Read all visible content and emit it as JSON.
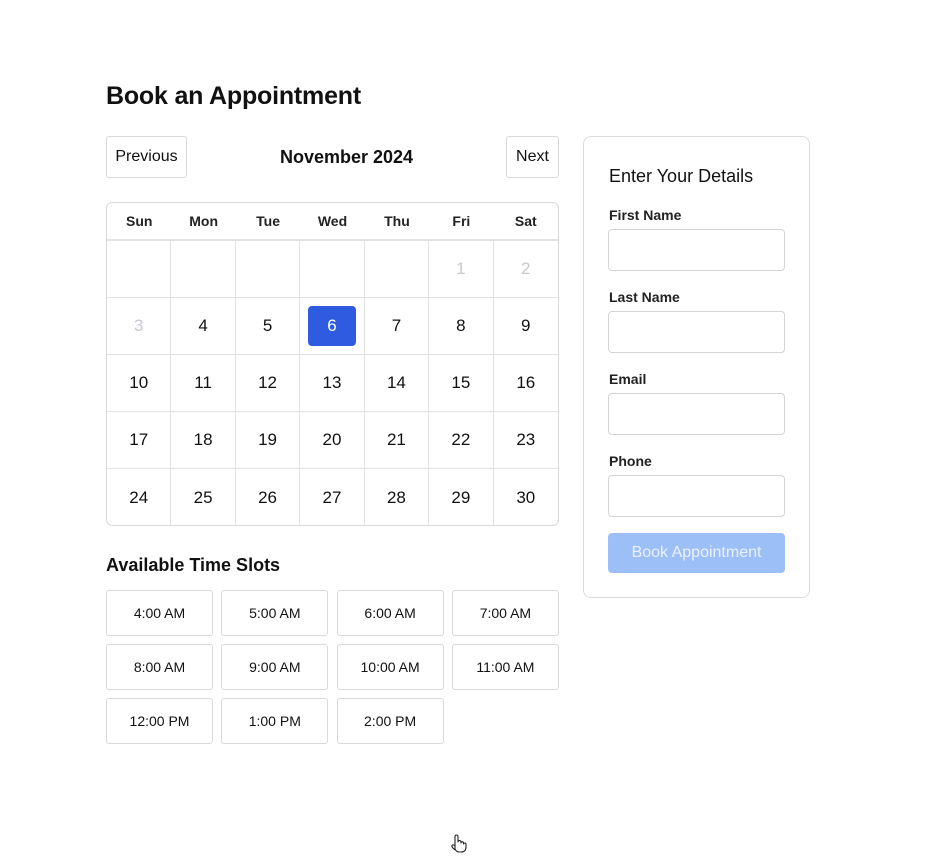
{
  "page": {
    "title": "Book an Appointment"
  },
  "calendar": {
    "prev_label": "Previous",
    "next_label": "Next",
    "month": "November 2024",
    "weekdays": [
      "Sun",
      "Mon",
      "Tue",
      "Wed",
      "Thu",
      "Fri",
      "Sat"
    ],
    "days": [
      {
        "label": "",
        "state": "empty"
      },
      {
        "label": "",
        "state": "empty"
      },
      {
        "label": "",
        "state": "empty"
      },
      {
        "label": "",
        "state": "empty"
      },
      {
        "label": "",
        "state": "empty"
      },
      {
        "label": "1",
        "state": "disabled"
      },
      {
        "label": "2",
        "state": "disabled"
      },
      {
        "label": "3",
        "state": "disabled"
      },
      {
        "label": "4",
        "state": "normal"
      },
      {
        "label": "5",
        "state": "normal"
      },
      {
        "label": "6",
        "state": "selected"
      },
      {
        "label": "7",
        "state": "normal"
      },
      {
        "label": "8",
        "state": "normal"
      },
      {
        "label": "9",
        "state": "normal"
      },
      {
        "label": "10",
        "state": "normal"
      },
      {
        "label": "11",
        "state": "normal"
      },
      {
        "label": "12",
        "state": "normal"
      },
      {
        "label": "13",
        "state": "normal"
      },
      {
        "label": "14",
        "state": "normal"
      },
      {
        "label": "15",
        "state": "normal"
      },
      {
        "label": "16",
        "state": "normal"
      },
      {
        "label": "17",
        "state": "normal"
      },
      {
        "label": "18",
        "state": "normal"
      },
      {
        "label": "19",
        "state": "normal"
      },
      {
        "label": "20",
        "state": "normal"
      },
      {
        "label": "21",
        "state": "normal"
      },
      {
        "label": "22",
        "state": "normal"
      },
      {
        "label": "23",
        "state": "normal"
      },
      {
        "label": "24",
        "state": "normal"
      },
      {
        "label": "25",
        "state": "normal"
      },
      {
        "label": "26",
        "state": "normal"
      },
      {
        "label": "27",
        "state": "normal"
      },
      {
        "label": "28",
        "state": "normal"
      },
      {
        "label": "29",
        "state": "normal"
      },
      {
        "label": "30",
        "state": "normal"
      }
    ]
  },
  "time_slots": {
    "title": "Available Time Slots",
    "slots": [
      "4:00 AM",
      "5:00 AM",
      "6:00 AM",
      "7:00 AM",
      "8:00 AM",
      "9:00 AM",
      "10:00 AM",
      "11:00 AM",
      "12:00 PM",
      "1:00 PM",
      "2:00 PM"
    ]
  },
  "details": {
    "title": "Enter Your Details",
    "fields": [
      {
        "label": "First Name",
        "value": ""
      },
      {
        "label": "Last Name",
        "value": ""
      },
      {
        "label": "Email",
        "value": ""
      },
      {
        "label": "Phone",
        "value": ""
      }
    ],
    "submit_label": "Book Appointment"
  },
  "colors": {
    "selected_day": "#2f5be0",
    "submit_disabled": "#9dbff8",
    "disabled_day_text": "#c8c8d0"
  },
  "icons": {
    "cursor": "hand-pointer-icon"
  }
}
